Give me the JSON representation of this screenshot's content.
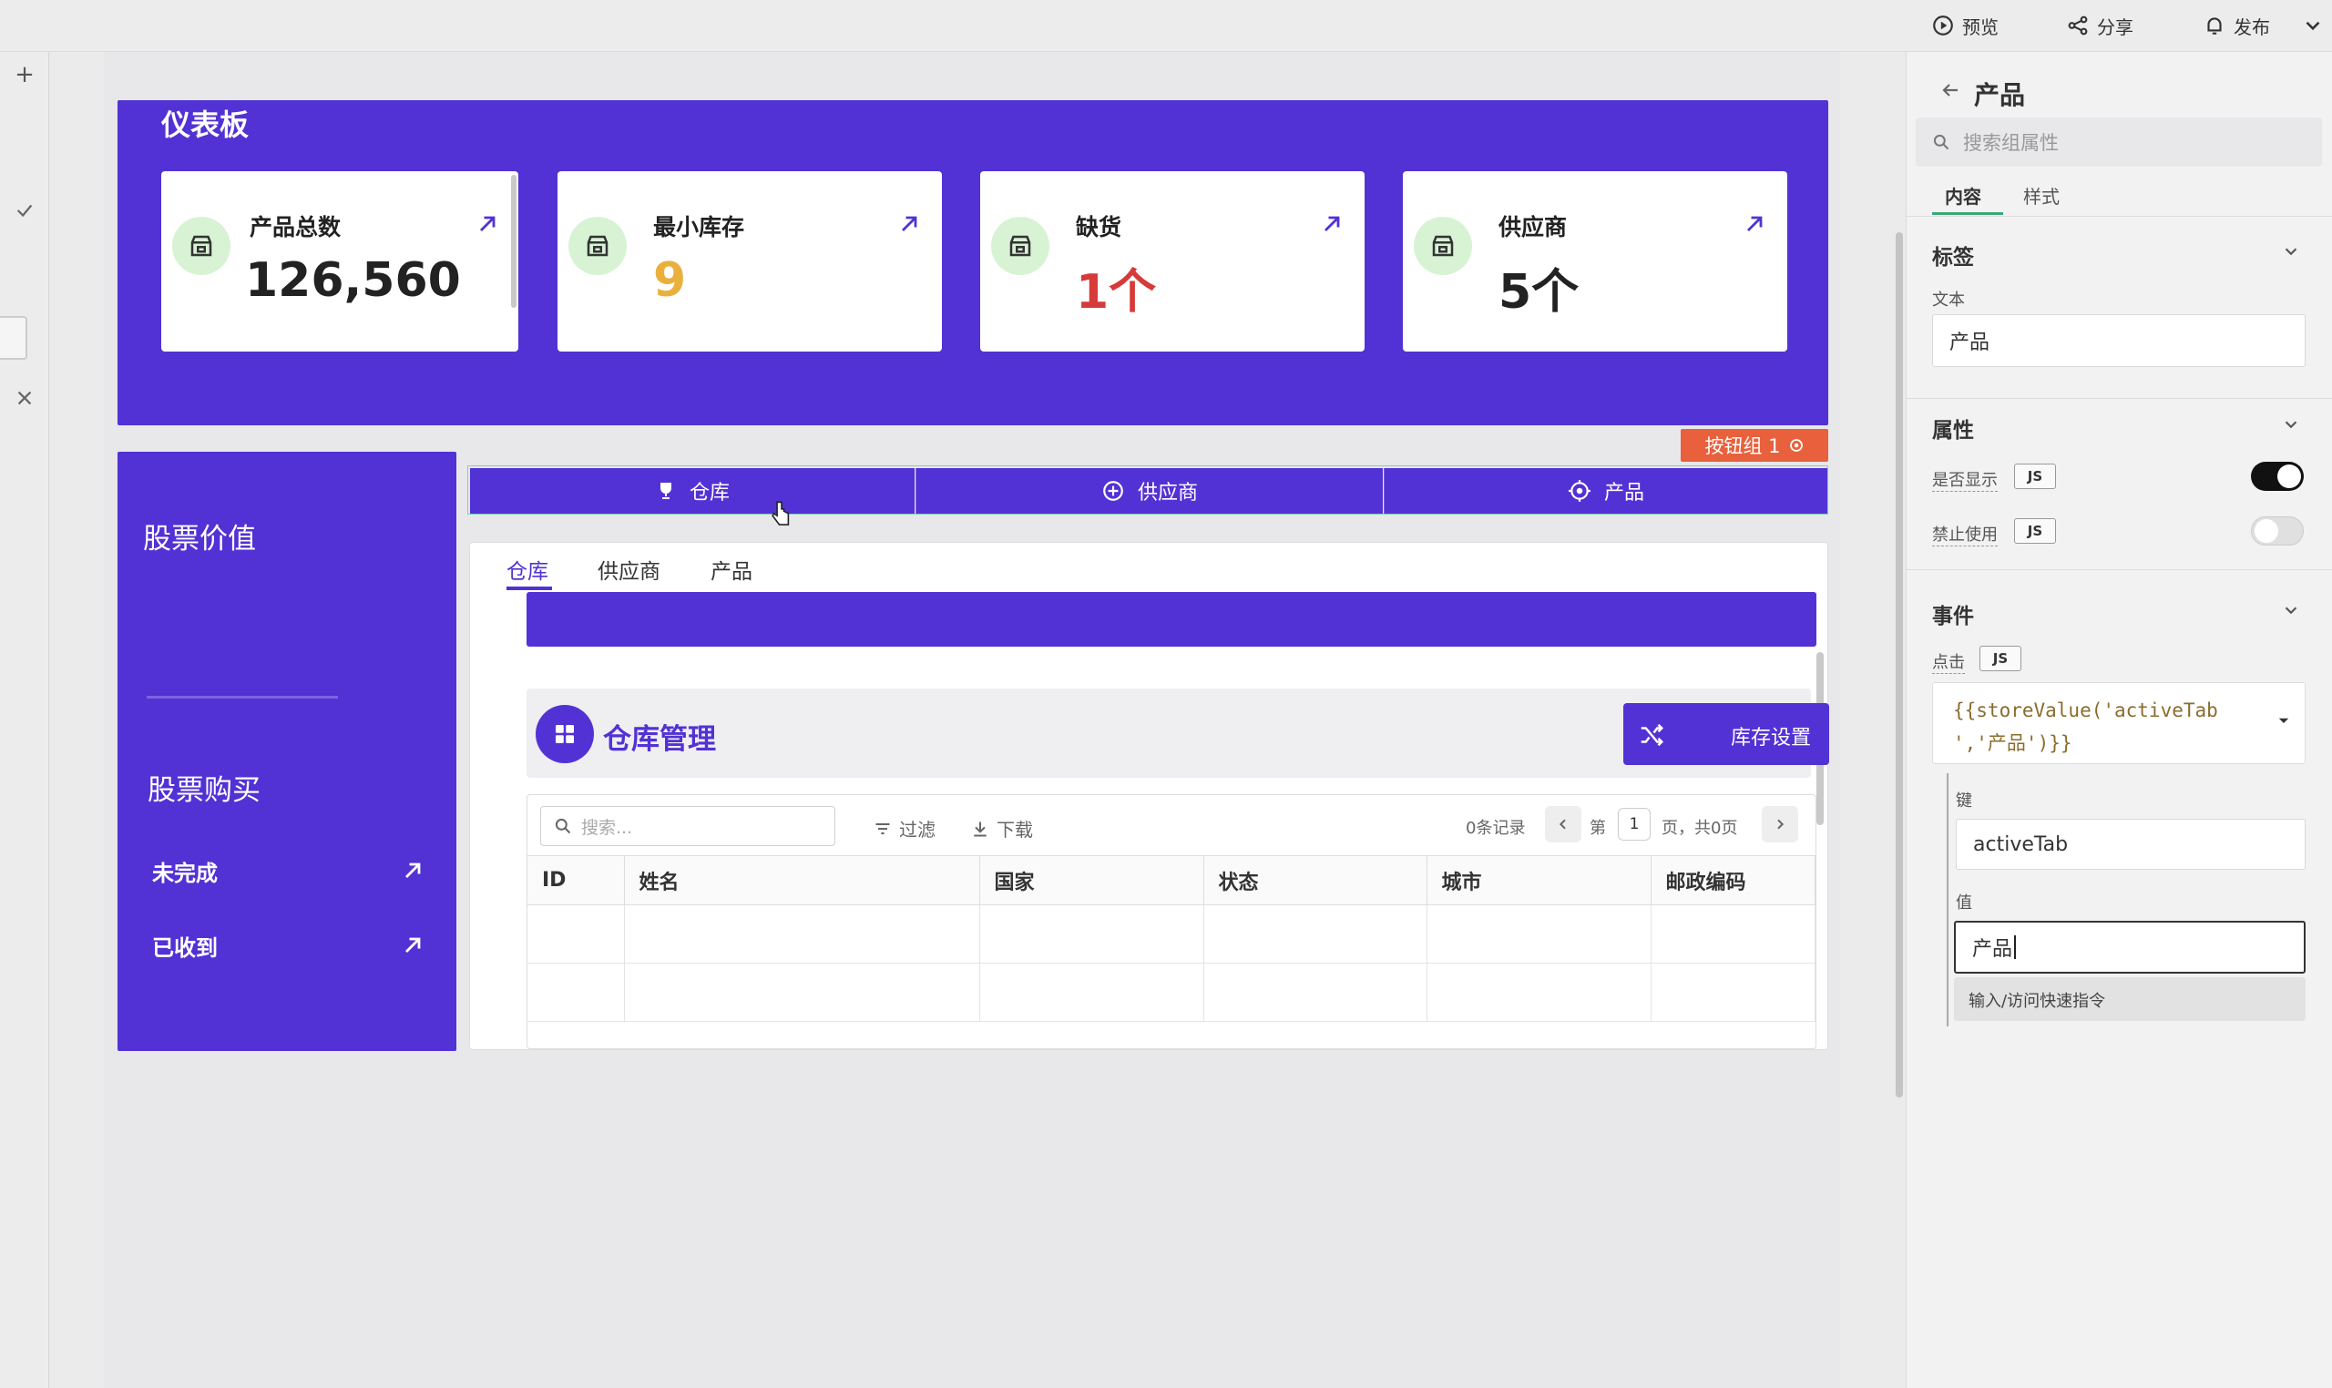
{
  "topbar": {
    "preview_label": "预览",
    "share_label": "分享",
    "publish_label": "发布"
  },
  "dashboard": {
    "title": "仪表板",
    "cards": [
      {
        "title": "产品总数",
        "value": "126,560",
        "value_color": "#222222"
      },
      {
        "title": "最小库存",
        "value": "9",
        "value_color": "#e9b13c"
      },
      {
        "title": "缺货",
        "value": "1个",
        "value_color": "#d63a3a"
      },
      {
        "title": "供应商",
        "value": "5个",
        "value_color": "#222222"
      }
    ]
  },
  "stock_panel": {
    "value_title": "股票价值",
    "buy_title": "股票购买",
    "items": [
      {
        "label": "未完成"
      },
      {
        "label": "已收到"
      }
    ]
  },
  "button_group": {
    "tag_label": "按钮组 1",
    "buttons": [
      {
        "label": "仓库",
        "icon": "trophy-icon"
      },
      {
        "label": "供应商",
        "icon": "plus-circle-icon"
      },
      {
        "label": "产品",
        "icon": "target-icon"
      }
    ]
  },
  "tabs": {
    "items": [
      {
        "label": "仓库",
        "active": true
      },
      {
        "label": "供应商",
        "active": false
      },
      {
        "label": "产品",
        "active": false
      }
    ]
  },
  "warehouse": {
    "title": "仓库管理",
    "settings_button": "库存设置",
    "table": {
      "search_placeholder": "搜索...",
      "filter_label": "过滤",
      "download_label": "下载",
      "records": "0条记录",
      "page_prefix": "第",
      "page_number": "1",
      "page_suffix": "页，共0页",
      "columns": [
        "ID",
        "姓名",
        "国家",
        "状态",
        "城市",
        "邮政编码"
      ]
    }
  },
  "right_panel": {
    "title": "产品",
    "search_placeholder": "搜索组属性",
    "tabs": [
      {
        "label": "内容",
        "active": true
      },
      {
        "label": "样式",
        "active": false
      }
    ],
    "label_section": {
      "title": "标签",
      "text_label": "文本",
      "text_value": "产品"
    },
    "props_section": {
      "title": "属性",
      "visible_label": "是否显示",
      "visible_on": true,
      "disabled_label": "禁止使用",
      "disabled_on": false,
      "js_badge": "JS"
    },
    "events_section": {
      "title": "事件",
      "click_label": "点击",
      "code_line1": "{{storeValue('activeTab",
      "code_line2": "','产品')}}",
      "key_label": "键",
      "key_value": "activeTab",
      "value_label": "值",
      "value_value": "产品",
      "hint": "输入/访问快速指令"
    }
  },
  "colors": {
    "primary": "#5232d4",
    "accent_tag": "#e8603c",
    "card_icon_bg": "#d7f3d4"
  }
}
